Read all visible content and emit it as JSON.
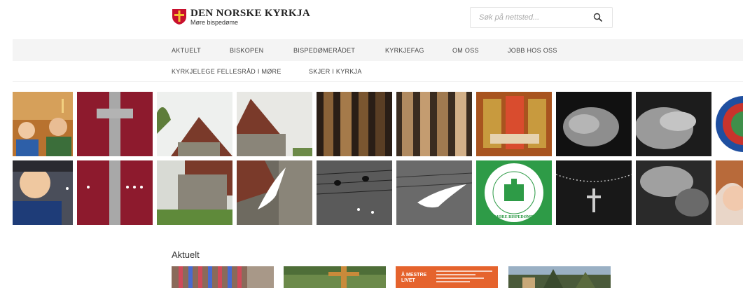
{
  "brand": {
    "title": "DEN NORSKE KYRKJA",
    "subtitle": "Møre bispedøme",
    "shield_red": "#c8102e",
    "shield_gold": "#f2c230"
  },
  "search": {
    "placeholder": "Søk på nettsted..."
  },
  "nav": {
    "row1": [
      "AKTUELT",
      "BISKOPEN",
      "BISPEDØMERÅDET",
      "KYRKJEFAG",
      "OM OSS",
      "JOBB HOS OSS"
    ],
    "row2": [
      "KYRKJELEGE FELLESRÅD I MØRE",
      "SKJER I KYRKJA"
    ]
  },
  "tiles": {
    "logo_ring_text": "MØRE BISPEDØME",
    "logo_green": "#2e9b47"
  },
  "sections": {
    "aktuelt": {
      "title": "Aktuelt",
      "card3_label": "Å MESTRE LIVET"
    }
  }
}
